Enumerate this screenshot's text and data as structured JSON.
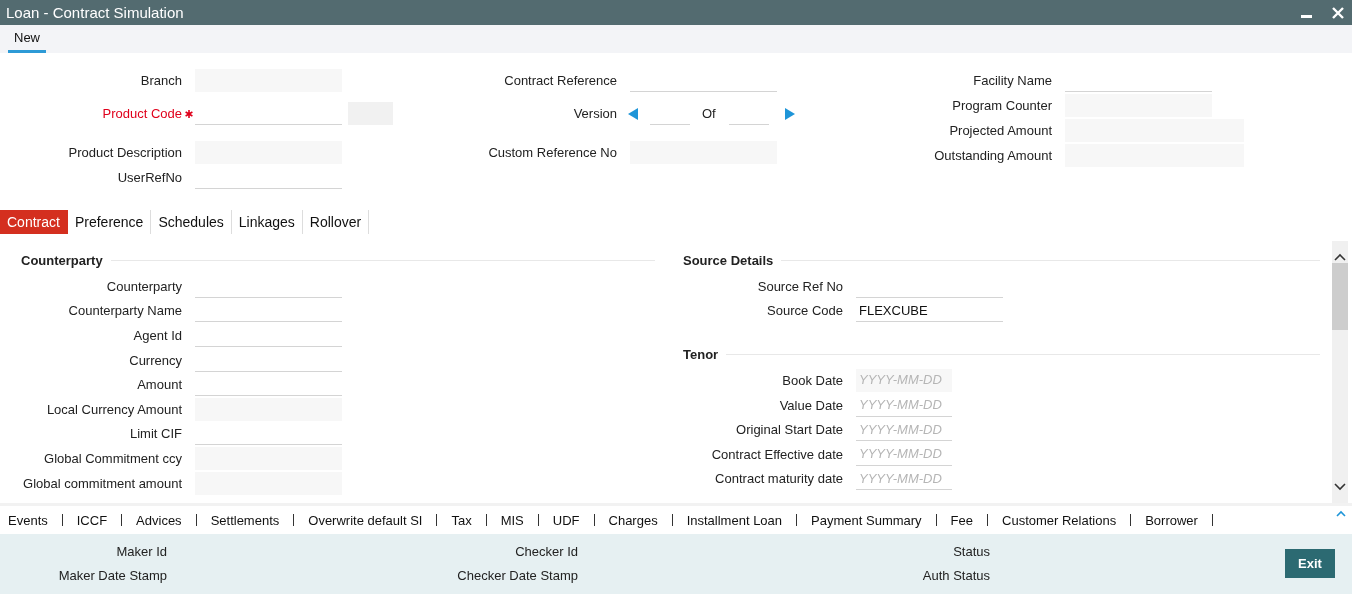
{
  "window": {
    "title": "Loan - Contract Simulation"
  },
  "toolbar": [
    {
      "label": "New",
      "selected": true
    }
  ],
  "header": {
    "columns": [
      [
        {
          "label": "Branch",
          "kind": "readonly",
          "required": false
        },
        {
          "label": "Product Code",
          "kind": "lookup",
          "required": true
        },
        {
          "label": "Product Description",
          "kind": "readonly",
          "required": false
        },
        {
          "label": "UserRefNo",
          "kind": "text",
          "required": false
        }
      ],
      [
        {
          "label": "Contract Reference",
          "kind": "text",
          "required": false
        },
        {
          "label": "Version",
          "kind": "version",
          "of_label": "Of",
          "required": false
        },
        {
          "label": "Custom Reference No",
          "kind": "readonly",
          "required": false
        }
      ],
      [
        {
          "label": "Facility Name",
          "kind": "text",
          "required": false
        },
        {
          "label": "Program Counter",
          "kind": "readonly",
          "required": false
        },
        {
          "label": "Projected Amount",
          "kind": "readonly",
          "required": false
        },
        {
          "label": "Outstanding Amount",
          "kind": "readonly",
          "required": false
        }
      ]
    ]
  },
  "tabs": [
    {
      "label": "Contract",
      "selected": true
    },
    {
      "label": "Preference",
      "selected": false
    },
    {
      "label": "Schedules",
      "selected": false
    },
    {
      "label": "Linkages",
      "selected": false
    },
    {
      "label": "Rollover",
      "selected": false
    }
  ],
  "panels": [
    {
      "sections": [
        {
          "title": "Counterparty",
          "fields": [
            {
              "label": "Counterparty",
              "kind": "text"
            },
            {
              "label": "Counterparty Name",
              "kind": "text"
            },
            {
              "label": "Agent Id",
              "kind": "text"
            },
            {
              "label": "Currency",
              "kind": "text"
            },
            {
              "label": "Amount",
              "kind": "text"
            },
            {
              "label": "Local Currency Amount",
              "kind": "readonly"
            },
            {
              "label": "Limit CIF",
              "kind": "text"
            },
            {
              "label": "Global Commitment ccy",
              "kind": "readonly"
            },
            {
              "label": "Global commitment amount",
              "kind": "readonly"
            }
          ]
        }
      ]
    },
    {
      "sections": [
        {
          "title": "Source Details",
          "fields": [
            {
              "label": "Source Ref No",
              "kind": "text"
            },
            {
              "label": "Source Code",
              "kind": "text",
              "value": "FLEXCUBE"
            }
          ]
        },
        {
          "title": "Tenor",
          "fields": [
            {
              "label": "Book Date",
              "kind": "readonly-date",
              "placeholder": "YYYY-MM-DD"
            },
            {
              "label": "Value Date",
              "kind": "date",
              "placeholder": "YYYY-MM-DD"
            },
            {
              "label": "Original Start Date",
              "kind": "date",
              "placeholder": "YYYY-MM-DD"
            },
            {
              "label": "Contract Effective date",
              "kind": "date",
              "placeholder": "YYYY-MM-DD"
            },
            {
              "label": "Contract maturity date",
              "kind": "date",
              "placeholder": "YYYY-MM-DD"
            }
          ]
        }
      ]
    }
  ],
  "links": [
    "Events",
    "ICCF",
    "Advices",
    "Settlements",
    "Overwrite default SI",
    "Tax",
    "MIS",
    "UDF",
    "Charges",
    "Installment Loan",
    "Payment Summary",
    "Fee",
    "Customer Relations",
    "Borrower"
  ],
  "footer": {
    "columns": [
      [
        "Maker Id",
        "Maker Date Stamp"
      ],
      [
        "Checker Id",
        "Checker Date Stamp"
      ],
      [
        "Status",
        "Auth Status"
      ]
    ],
    "exit_button": "Exit"
  }
}
